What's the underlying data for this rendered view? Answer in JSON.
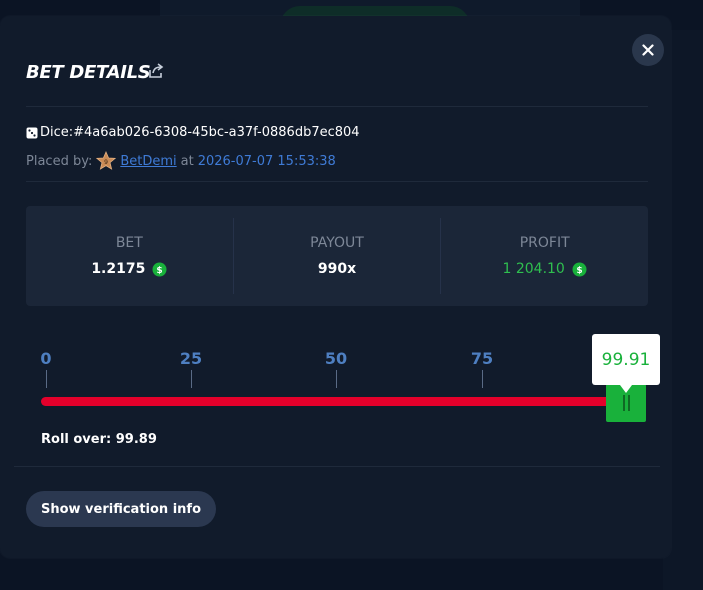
{
  "modal": {
    "title": "BET DETAILS",
    "bet_id": "Dice:#4a6ab026-6308-45bc-a37f-0886db7ec804",
    "placed_by_label": "Placed by:",
    "user_rank": "9",
    "username": "BetDemi",
    "at_label": "at",
    "timestamp": "2026-07-07 15:53:38"
  },
  "stats": [
    {
      "label": "BET",
      "value": "1.2175",
      "has_coin": true,
      "color": "#ffffff"
    },
    {
      "label": "PAYOUT",
      "value": "990x",
      "has_coin": false,
      "color": "#ffffff"
    },
    {
      "label": "PROFIT",
      "value": "1 204.10",
      "has_coin": true,
      "color": "#2fbf4f"
    }
  ],
  "slider": {
    "ticks": [
      "0",
      "25",
      "50",
      "75"
    ],
    "value_label": "99.91",
    "value": 99.91,
    "roll_over_label": "Roll over:",
    "roll_over_value": "99.89"
  },
  "buttons": {
    "verification": "Show verification info"
  },
  "colors": {
    "accent_green": "#19b13b",
    "track_red": "#e4002b",
    "link_blue": "#3f7bd6"
  }
}
